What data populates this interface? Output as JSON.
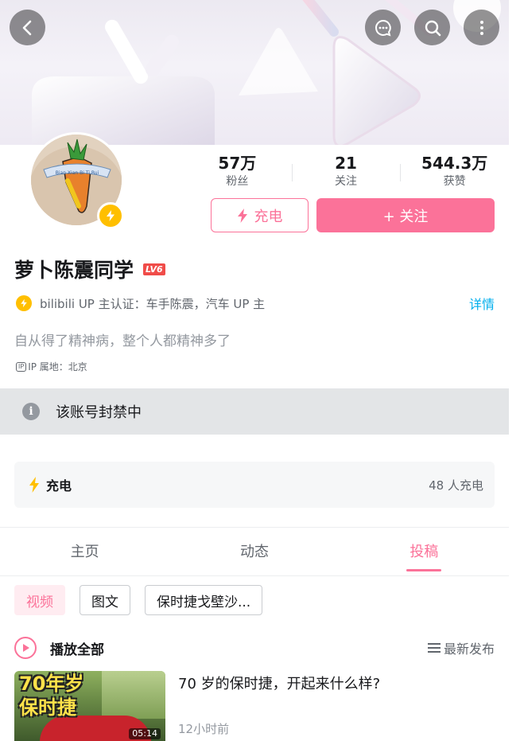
{
  "profile": {
    "name": "萝卜陈震同学",
    "level_badge": "LV6",
    "cert_text": "bilibili UP 主认证：车手陈震，汽车 UP 主",
    "cert_detail": "详情",
    "bio": "自从得了精神病，整个人都精神多了",
    "ip_tag": "IP",
    "ip_location": "IP 属地：北京",
    "avatar_text": "Bian Xian Bi Ti Rui"
  },
  "stats": [
    {
      "value": "57万",
      "label": "粉丝"
    },
    {
      "value": "21",
      "label": "关注"
    },
    {
      "value": "544.3万",
      "label": "获赞"
    }
  ],
  "actions": {
    "charge_label": "充电",
    "follow_label": "+ 关注"
  },
  "notice": {
    "icon": "i",
    "text": "该账号封禁中"
  },
  "charge_card": {
    "label": "充电",
    "count": "48 人充电"
  },
  "tabs": [
    {
      "label": "主页"
    },
    {
      "label": "动态"
    },
    {
      "label": "投稿"
    }
  ],
  "filters": [
    {
      "label": "视频"
    },
    {
      "label": "图文"
    },
    {
      "label": "保时捷戈壁沙..."
    }
  ],
  "playlist": {
    "play_all_label": "播放全部",
    "sort_label": "最新发布"
  },
  "videos": [
    {
      "thumb_line1": "70年岁",
      "thumb_line2": "保时捷",
      "duration": "05:14",
      "title": "70 岁的保时捷，开起来什么样?",
      "time": "12小时前"
    }
  ],
  "icons": {
    "back": "back-arrow-icon",
    "message": "message-icon",
    "search": "search-icon",
    "more": "more-icon",
    "lightning": "lightning-icon",
    "info": "info-icon",
    "play": "play-icon",
    "sort": "sort-icon"
  },
  "colors": {
    "accent": "#fb7299",
    "verify": "#ffbf00",
    "link": "#00aeec",
    "notice_bg": "#e3e5e7"
  }
}
